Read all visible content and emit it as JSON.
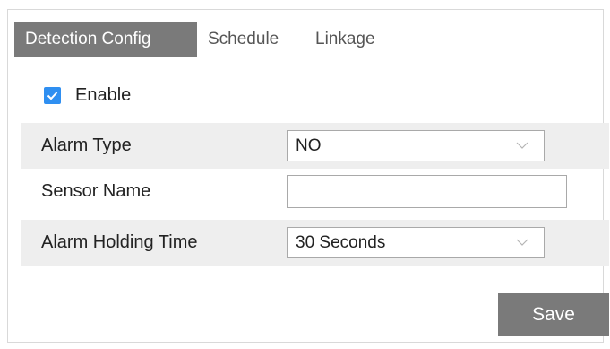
{
  "tabs": [
    {
      "label": "Detection Config",
      "active": true
    },
    {
      "label": "Schedule",
      "active": false
    },
    {
      "label": "Linkage",
      "active": false
    }
  ],
  "enable": {
    "label": "Enable",
    "checked": true
  },
  "form": {
    "alarm_type": {
      "label": "Alarm Type",
      "value": "NO"
    },
    "sensor_name": {
      "label": "Sensor Name",
      "value": "",
      "placeholder": ""
    },
    "alarm_holding_time": {
      "label": "Alarm Holding Time",
      "value": "30 Seconds"
    }
  },
  "save_label": "Save",
  "colors": {
    "tab_active": "#7a7a7a",
    "checkbox": "#2f8ff1",
    "row_shade": "#eeeeee",
    "button": "#7a7a7a"
  }
}
